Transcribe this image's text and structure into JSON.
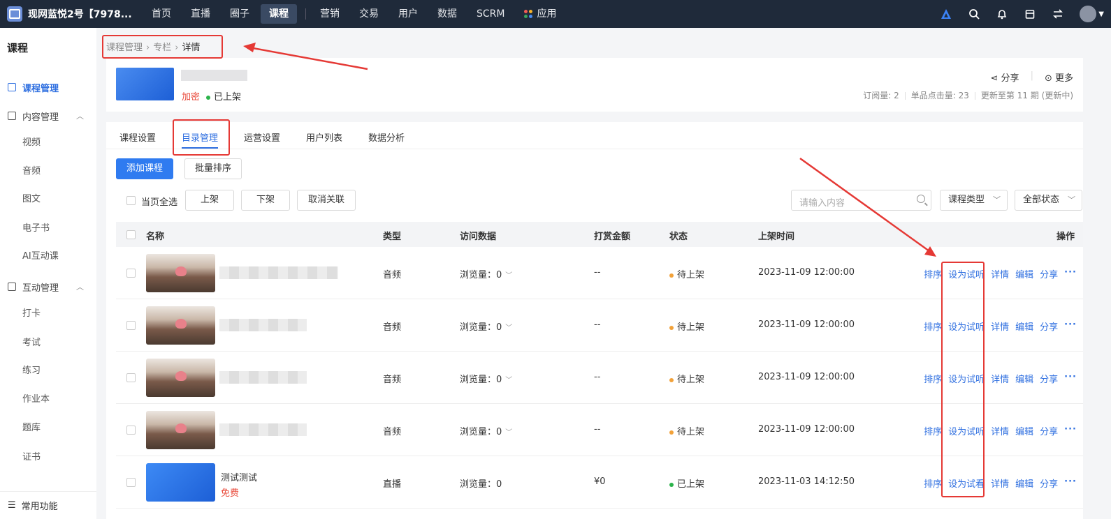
{
  "topbar": {
    "shop_name": "现网蓝悦2号【7978...",
    "nav": [
      "首页",
      "直播",
      "圈子",
      "课程",
      "营销",
      "交易",
      "用户",
      "数据",
      "SCRM",
      "应用"
    ],
    "active_index": 3
  },
  "sidebar": {
    "title": "课程",
    "course_mgmt": "课程管理",
    "content_mgmt": "内容管理",
    "content_items": [
      "视频",
      "音频",
      "图文",
      "电子书",
      "AI互动课"
    ],
    "interact_mgmt": "互动管理",
    "interact_items": [
      "打卡",
      "考试",
      "练习",
      "作业本",
      "题库",
      "证书"
    ],
    "common": "常用功能"
  },
  "breadcrumb": [
    "课程管理",
    "专栏",
    "详情"
  ],
  "header": {
    "tag_encrypted": "加密",
    "status": "已上架",
    "share": "分享",
    "more": "更多",
    "stats": [
      "订阅量: 2",
      "单品点击量: 23",
      "更新至第 11 期 (更新中)"
    ]
  },
  "tabs": [
    "课程设置",
    "目录管理",
    "运营设置",
    "用户列表",
    "数据分析"
  ],
  "active_tab": 1,
  "toolbar": {
    "add_course": "添加课程",
    "batch_sort": "批量排序",
    "select_page": "当页全选",
    "list_on": "上架",
    "list_off": "下架",
    "unlink": "取消关联",
    "search_placeholder": "请输入内容",
    "type_filter": "课程类型",
    "status_filter": "全部状态"
  },
  "table": {
    "headers": [
      "名称",
      "类型",
      "访问数据",
      "打赏金额",
      "状态",
      "上架时间",
      "操作"
    ],
    "rows": [
      {
        "type": "音频",
        "views_label": "浏览量：",
        "views": "0",
        "reward": "--",
        "status": "待上架",
        "time": "2023-11-09 12:00:00",
        "ops": [
          "排序",
          "设为试听",
          "详情",
          "编辑",
          "分享",
          "···"
        ]
      },
      {
        "type": "音频",
        "views_label": "浏览量：",
        "views": "0",
        "reward": "--",
        "status": "待上架",
        "time": "2023-11-09 12:00:00",
        "ops": [
          "排序",
          "设为试听",
          "详情",
          "编辑",
          "分享",
          "···"
        ]
      },
      {
        "type": "音频",
        "views_label": "浏览量：",
        "views": "0",
        "reward": "--",
        "status": "待上架",
        "time": "2023-11-09 12:00:00",
        "ops": [
          "排序",
          "设为试听",
          "详情",
          "编辑",
          "分享",
          "···"
        ]
      },
      {
        "type": "音频",
        "views_label": "浏览量：",
        "views": "0",
        "reward": "--",
        "status": "待上架",
        "time": "2023-11-09 12:00:00",
        "ops": [
          "排序",
          "设为试听",
          "详情",
          "编辑",
          "分享",
          "···"
        ]
      },
      {
        "name": "测试测试",
        "price_tag": "免费",
        "type": "直播",
        "views_label": "浏览量：",
        "views": "0",
        "reward": "¥0",
        "status": "已上架",
        "time": "2023-11-03 14:12:50",
        "ops": [
          "排序",
          "设为试看",
          "详情",
          "编辑",
          "分享",
          "···"
        ]
      }
    ]
  },
  "colors": {
    "primary": "#2f6fe0",
    "topbar": "#1f2a3a",
    "danger": "#e94b3c",
    "annotation": "#e53935"
  }
}
